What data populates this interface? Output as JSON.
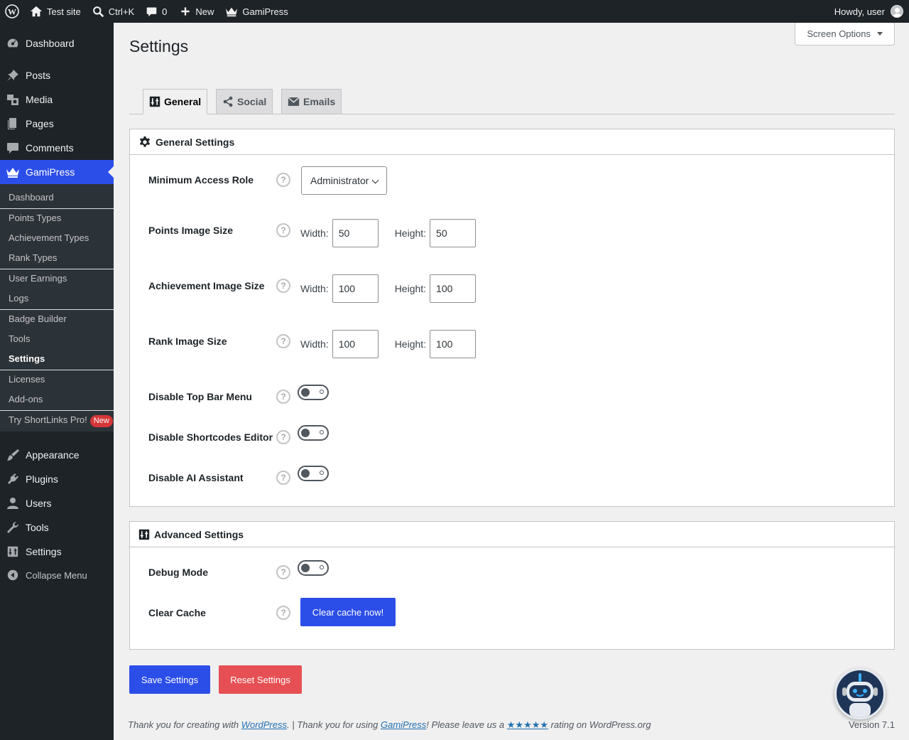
{
  "adminbar": {
    "site_name": "Test site",
    "search_shortcut": "Ctrl+K",
    "comments_count": "0",
    "new_label": "New",
    "plugin_label": "GamiPress",
    "howdy": "Howdy, user"
  },
  "sidebar": {
    "top": [
      {
        "label": "Dashboard",
        "icon": "dashboard-icon"
      },
      {
        "label": "Posts",
        "icon": "pin-icon"
      },
      {
        "label": "Media",
        "icon": "media-icon"
      },
      {
        "label": "Pages",
        "icon": "pages-icon"
      },
      {
        "label": "Comments",
        "icon": "comment-icon"
      },
      {
        "label": "GamiPress",
        "icon": "crown-icon"
      }
    ],
    "submenu": [
      "Dashboard",
      "Points Types",
      "Achievement Types",
      "Rank Types",
      "User Earnings",
      "Logs",
      "Badge Builder",
      "Tools",
      "Settings",
      "Licenses",
      "Add-ons",
      "Try ShortLinks Pro!"
    ],
    "new_badge": "New",
    "bottom": [
      {
        "label": "Appearance",
        "icon": "brush-icon"
      },
      {
        "label": "Plugins",
        "icon": "plugin-icon"
      },
      {
        "label": "Users",
        "icon": "user-icon"
      },
      {
        "label": "Tools",
        "icon": "wrench-icon"
      },
      {
        "label": "Settings",
        "icon": "settings-icon"
      }
    ],
    "collapse": "Collapse Menu"
  },
  "main": {
    "screen_options": "Screen Options",
    "title": "Settings",
    "tabs": [
      "General",
      "Social",
      "Emails"
    ],
    "general": {
      "heading": "General Settings",
      "min_role_label": "Minimum Access Role",
      "min_role_value": "Administrator",
      "points_label": "Points Image Size",
      "achievement_label": "Achievement Image Size",
      "rank_label": "Rank Image Size",
      "width_label": "Width:",
      "height_label": "Height:",
      "points_w": "50",
      "points_h": "50",
      "achievement_w": "100",
      "achievement_h": "100",
      "rank_w": "100",
      "rank_h": "100",
      "top_bar_label": "Disable Top Bar Menu",
      "shortcodes_label": "Disable Shortcodes Editor",
      "ai_label": "Disable AI Assistant"
    },
    "advanced": {
      "heading": "Advanced Settings",
      "debug_label": "Debug Mode",
      "cache_label": "Clear Cache",
      "cache_button": "Clear cache now!"
    },
    "save_button": "Save Settings",
    "reset_button": "Reset Settings",
    "help_glyph": "?",
    "footer": {
      "part1": "Thank you for creating with ",
      "wp_link": "WordPress",
      "part2": ". | Thank you for using ",
      "gp_link": "GamiPress",
      "part3": "! Please leave us a ",
      "stars": "★★★★★",
      "part4": " rating on WordPress.org"
    },
    "version": "Version 7.1"
  },
  "colors": {
    "accent": "#2c4ee8",
    "danger": "#e65054",
    "adminbar": "#1d2327"
  }
}
